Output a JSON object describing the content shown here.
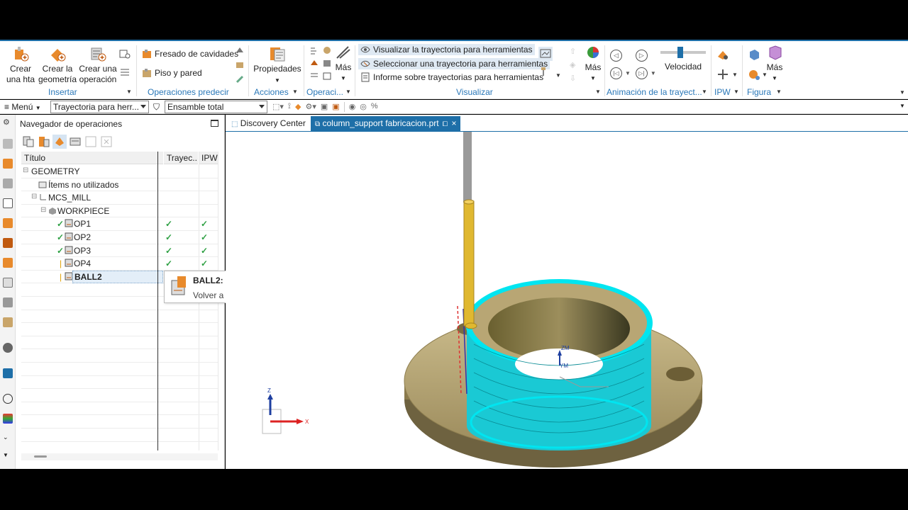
{
  "ribbon": {
    "insert": {
      "create_tool": "Crear\nuna hta",
      "create_geometry": "Crear la\ngeometría",
      "create_operation": "Crear una\noperación",
      "group": "Insertar"
    },
    "predefined_ops": {
      "cavity_milling": "Fresado de cavidades",
      "floor_wall": "Piso y pared",
      "group": "Operaciones predecir"
    },
    "actions": {
      "properties": "Propiedades",
      "group": "Acciones"
    },
    "operations": {
      "more": "Más",
      "group": "Operaci..."
    },
    "visualize": {
      "show_toolpath": "Visualizar la trayectoria para herramientas",
      "select_toolpath": "Seleccionar una trayectoria para herramientas",
      "toolpath_report": "Informe sobre trayectorias para herramientas",
      "more": "Más",
      "group": "Visualizar"
    },
    "animation": {
      "speed": "Velocidad",
      "group": "Animación de la trayect..."
    },
    "ipw": {
      "group": "IPW"
    },
    "figure": {
      "more": "Más",
      "group": "Figura"
    }
  },
  "toolbar": {
    "menu": "Menú",
    "filter_select": "Trayectoria para herr...",
    "assembly_select": "Ensamble total"
  },
  "navigator": {
    "title": "Navegador de operaciones",
    "columns": [
      "Título",
      "Trayec...",
      "IPW"
    ],
    "rows": [
      {
        "name": "GEOMETRY",
        "path": "",
        "ipw": ""
      },
      {
        "name": "Ítems no utilizados",
        "path": "",
        "ipw": ""
      },
      {
        "name": "MCS_MILL",
        "path": "",
        "ipw": ""
      },
      {
        "name": "WORKPIECE",
        "path": "",
        "ipw": ""
      },
      {
        "name": "OP1",
        "path": "✓",
        "ipw": "✓"
      },
      {
        "name": "OP2",
        "path": "✓",
        "ipw": "✓"
      },
      {
        "name": "OP3",
        "path": "✓",
        "ipw": "✓"
      },
      {
        "name": "OP4",
        "path": "✓",
        "ipw": "✓"
      },
      {
        "name": "BALL2",
        "path": "",
        "ipw": ""
      }
    ],
    "tooltip": {
      "title": "BALL2:",
      "text": "Volver a postprocesar"
    }
  },
  "tabs": [
    {
      "label": "Discovery Center"
    },
    {
      "label": "column_support fabricacion.prt"
    }
  ],
  "viewport": {
    "triad_labels": {
      "z": "Z",
      "x": "X"
    },
    "wcs_labels": {
      "zm": "ZM",
      "ym": "YM"
    }
  },
  "colors": {
    "accent": "#1e6fa8",
    "group_label": "#2b78b8",
    "check": "#2ea043",
    "part": "#bfae7c",
    "toolpath": "#00e5f0",
    "tool_holder": "#e0b830"
  }
}
